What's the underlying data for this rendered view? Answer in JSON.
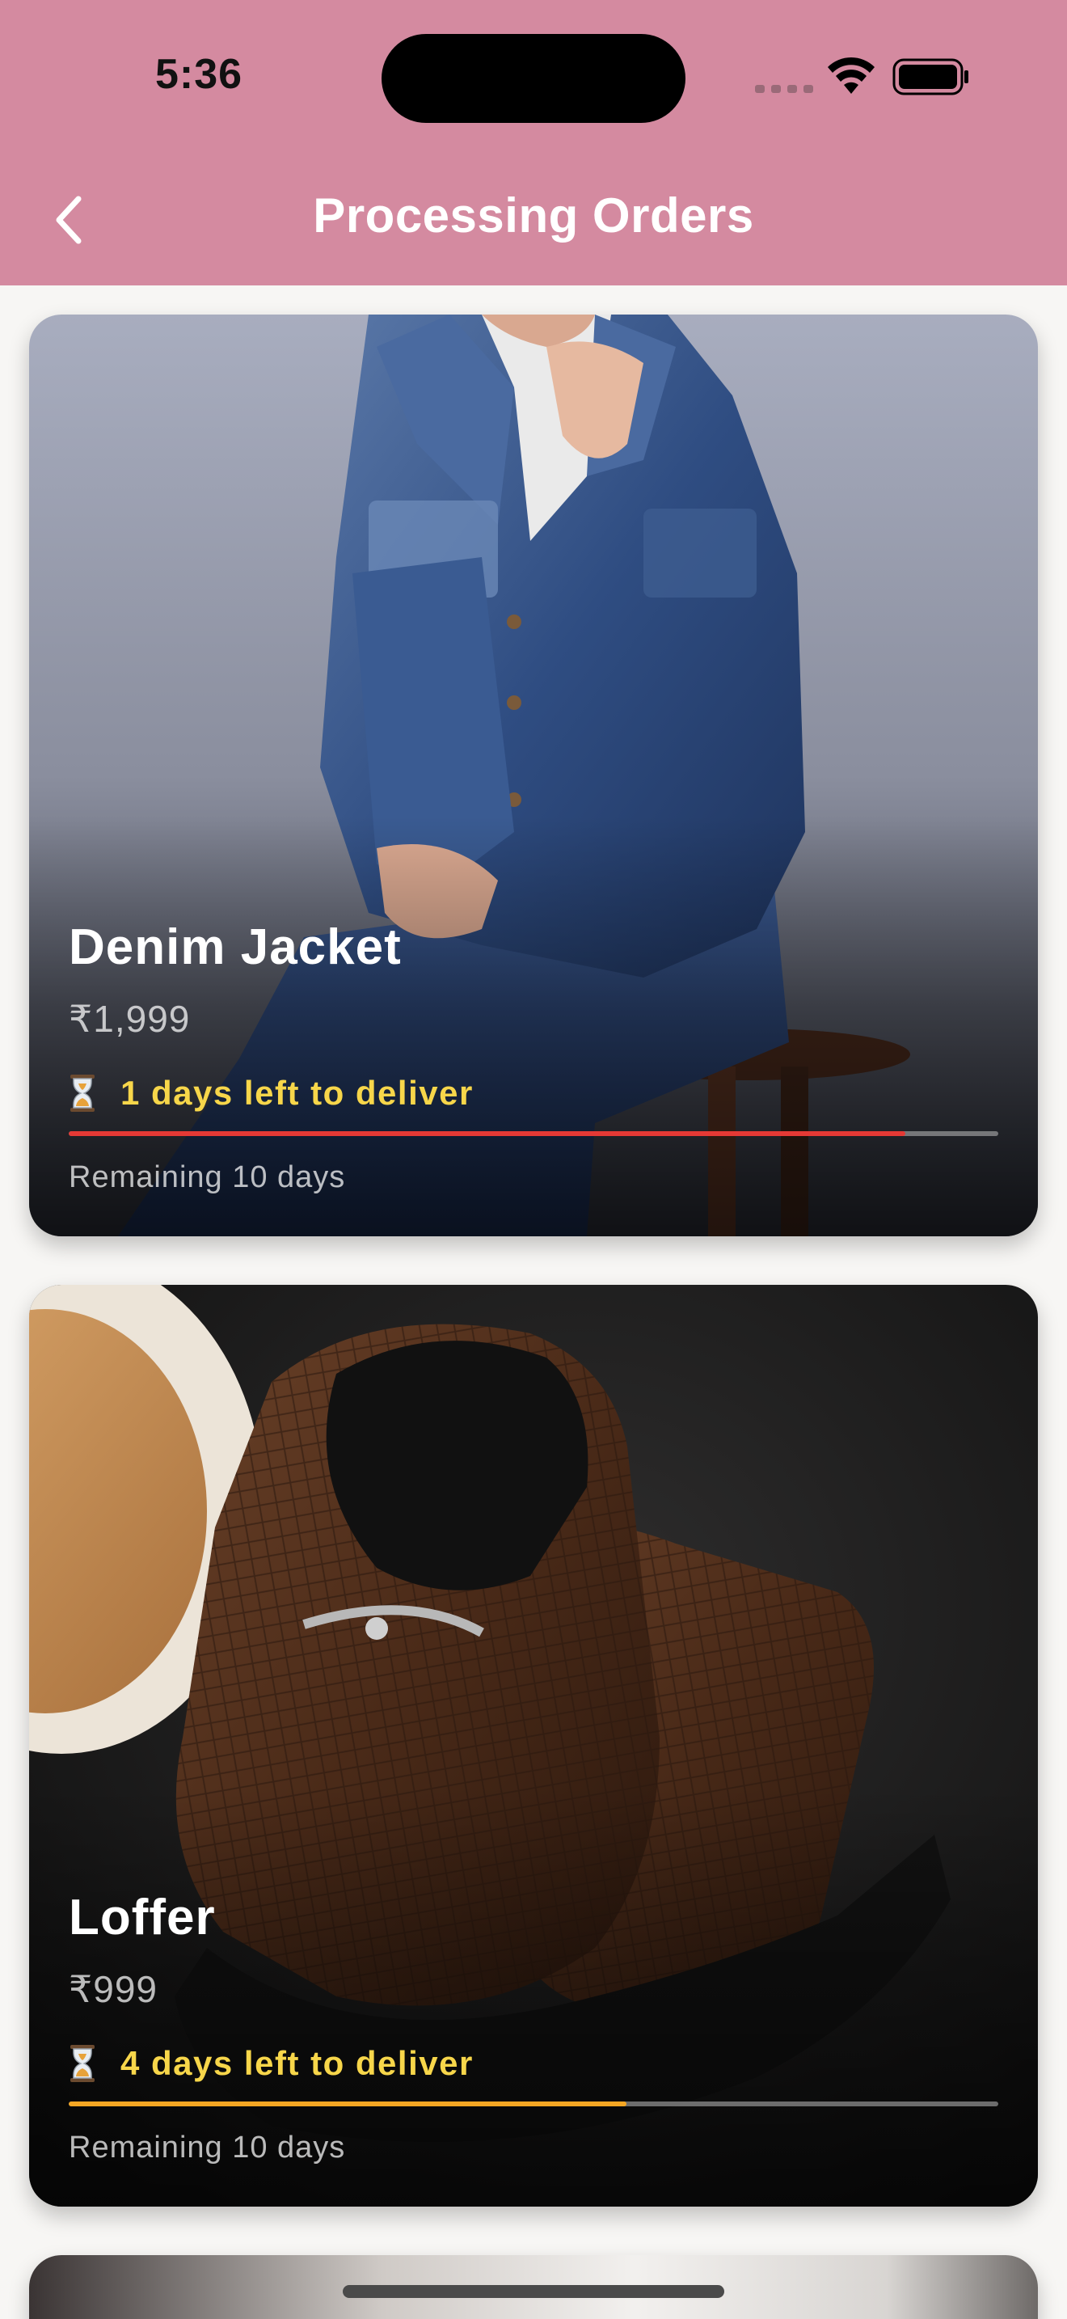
{
  "status_bar": {
    "time": "5:36"
  },
  "header": {
    "title": "Processing Orders",
    "background_color": "#d48aa0",
    "back_icon": "chevron-left-icon"
  },
  "orders": [
    {
      "name": "Denim Jacket",
      "price": "₹1,999",
      "delivery_text": "1 days left to deliver",
      "remaining_text": "Remaining 10 days",
      "progress": 0.9,
      "progress_color": "#e53935",
      "icon": "hourglass-icon"
    },
    {
      "name": "Loffer",
      "price": "₹999",
      "delivery_text": "4 days left to deliver",
      "remaining_text": "Remaining 10 days",
      "progress": 0.6,
      "progress_color": "#f5a623",
      "icon": "hourglass-icon"
    }
  ],
  "colors": {
    "delivery_text": "#f7d64a",
    "page_background": "#f7f6f4"
  }
}
